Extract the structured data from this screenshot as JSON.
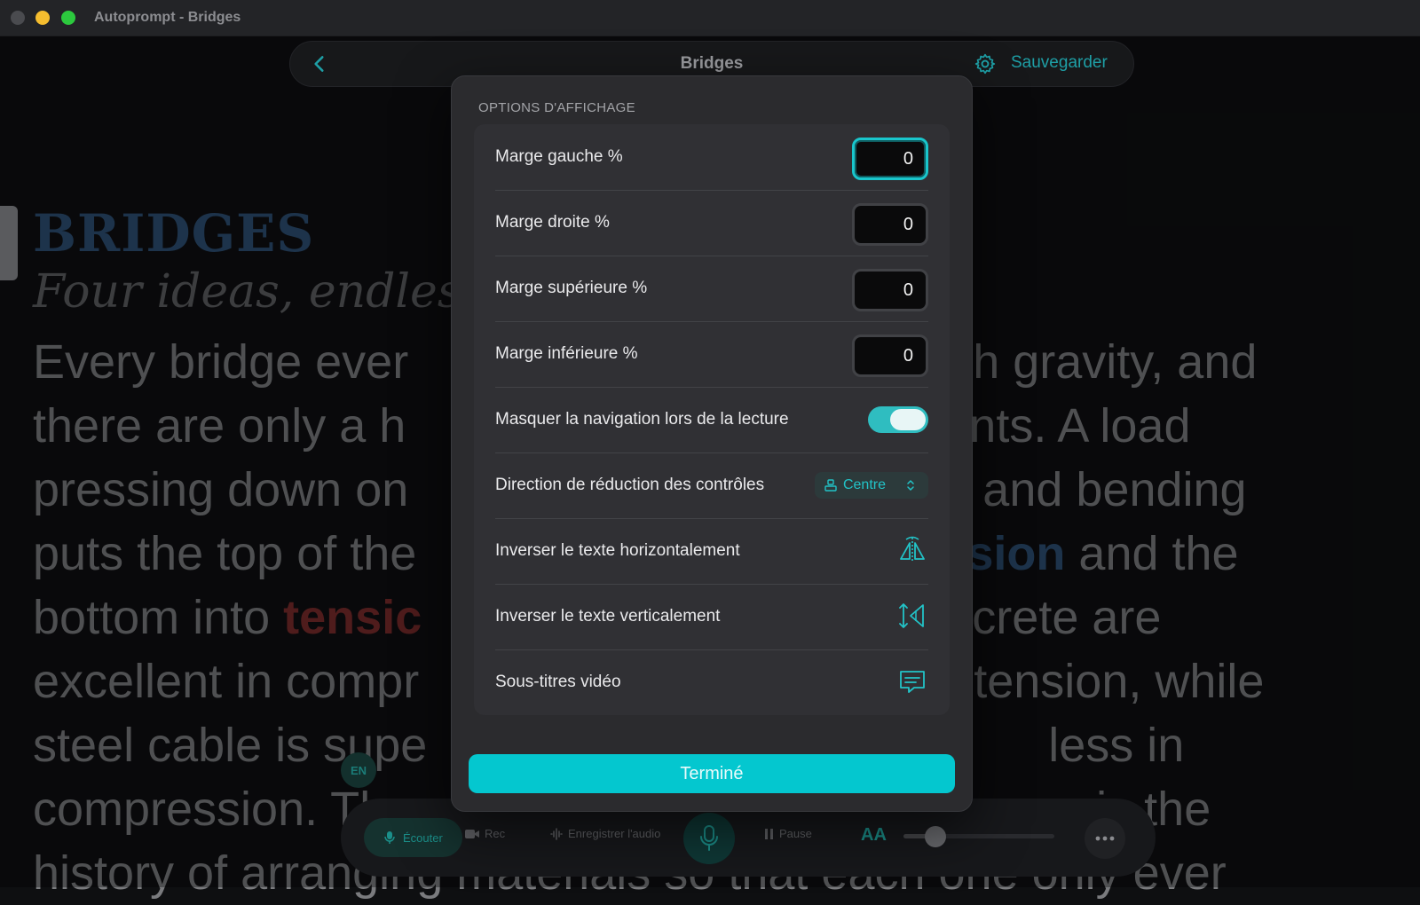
{
  "window": {
    "title": "Autoprompt - Bridges"
  },
  "nav": {
    "title": "Bridges",
    "save_label": "Sauvegarder"
  },
  "script": {
    "heading": "BRIDGES",
    "subheading": "Four ideas, endles",
    "lines": [
      [
        "Every bridge ever",
        "with gravity, and"
      ],
      [
        "there are only a h",
        "ments. A load"
      ],
      [
        "pressing down on",
        "it, and bending"
      ],
      [
        "puts the top of the",
        "ession",
        " and the"
      ],
      [
        "bottom into ",
        "tensic",
        "oncrete are"
      ],
      [
        "excellent in compr",
        "n tension, while"
      ],
      [
        "steel cable is supe",
        "less in"
      ],
      [
        "compression. Th",
        "is the"
      ],
      [
        "history of arranging materials so that each one only ever"
      ]
    ]
  },
  "modal": {
    "section_title": "OPTIONS D'AFFICHAGE",
    "rows": [
      {
        "label": "Marge gauche %",
        "value": "0"
      },
      {
        "label": "Marge droite %",
        "value": "0"
      },
      {
        "label": "Marge supérieure %",
        "value": "0"
      },
      {
        "label": "Marge inférieure %",
        "value": "0"
      },
      {
        "label": "Masquer la navigation lors de la lecture",
        "toggle_on": true
      },
      {
        "label": "Direction de réduction des contrôles",
        "select_value": "Centre"
      },
      {
        "label": "Inverser le texte horizontalement",
        "icon": "flip-horizontal-icon"
      },
      {
        "label": "Inverser le texte verticalement",
        "icon": "flip-vertical-icon"
      },
      {
        "label": "Sous-titres vidéo",
        "icon": "captions-icon"
      }
    ],
    "done_label": "Terminé"
  },
  "toolbar": {
    "listen_label": "Écouter",
    "rec_label": "Rec",
    "record_audio_label": "Enregistrer l'audio",
    "pause_label": "Pause",
    "font_size_label": "AA",
    "language": "EN"
  },
  "colors": {
    "accent": "#04c7cf",
    "background": "#0e0f11",
    "modal": "#2b2b2e"
  }
}
